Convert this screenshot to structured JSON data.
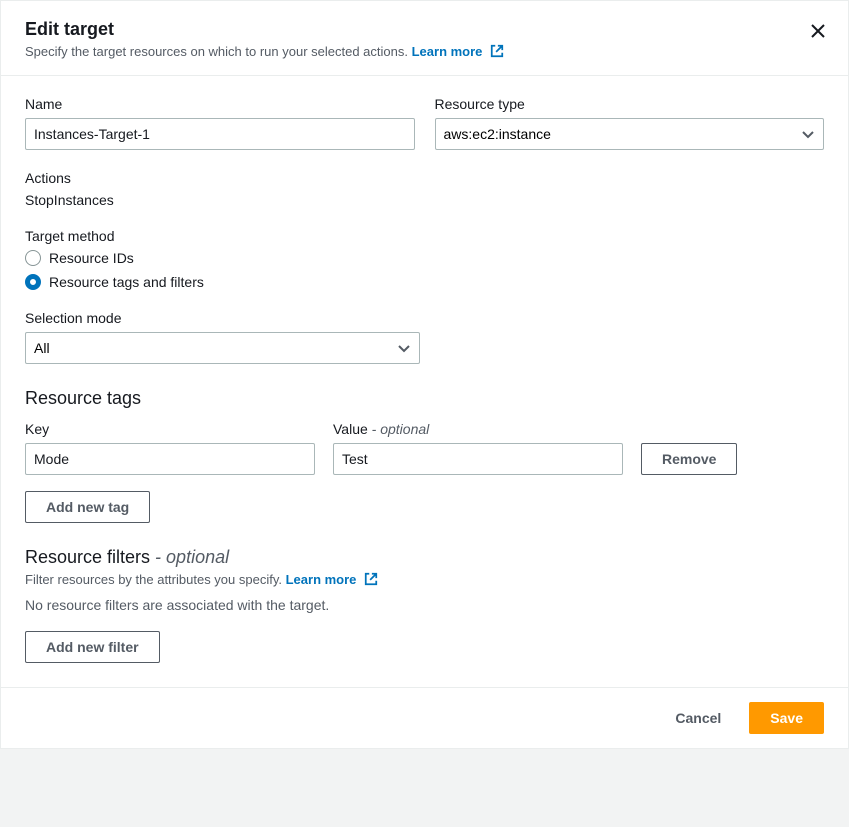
{
  "header": {
    "title": "Edit target",
    "subtitle": "Specify the target resources on which to run your selected actions.",
    "learn_more": "Learn more"
  },
  "form": {
    "name_label": "Name",
    "name_value": "Instances-Target-1",
    "resource_type_label": "Resource type",
    "resource_type_value": "aws:ec2:instance",
    "actions_label": "Actions",
    "actions_value": "StopInstances",
    "target_method_label": "Target method",
    "target_method_options": {
      "ids": "Resource IDs",
      "tags": "Resource tags and filters"
    },
    "selection_mode_label": "Selection mode",
    "selection_mode_value": "All"
  },
  "tags": {
    "section_title": "Resource tags",
    "key_label": "Key",
    "value_label": "Value",
    "value_optional": " - optional",
    "rows": [
      {
        "key": "Mode",
        "value": "Test"
      }
    ],
    "remove_label": "Remove",
    "add_label": "Add new tag"
  },
  "filters": {
    "section_title": "Resource filters",
    "section_suffix": " - optional",
    "description": "Filter resources by the attributes you specify.",
    "learn_more": "Learn more",
    "empty": "No resource filters are associated with the target.",
    "add_label": "Add new filter"
  },
  "footer": {
    "cancel": "Cancel",
    "save": "Save"
  }
}
